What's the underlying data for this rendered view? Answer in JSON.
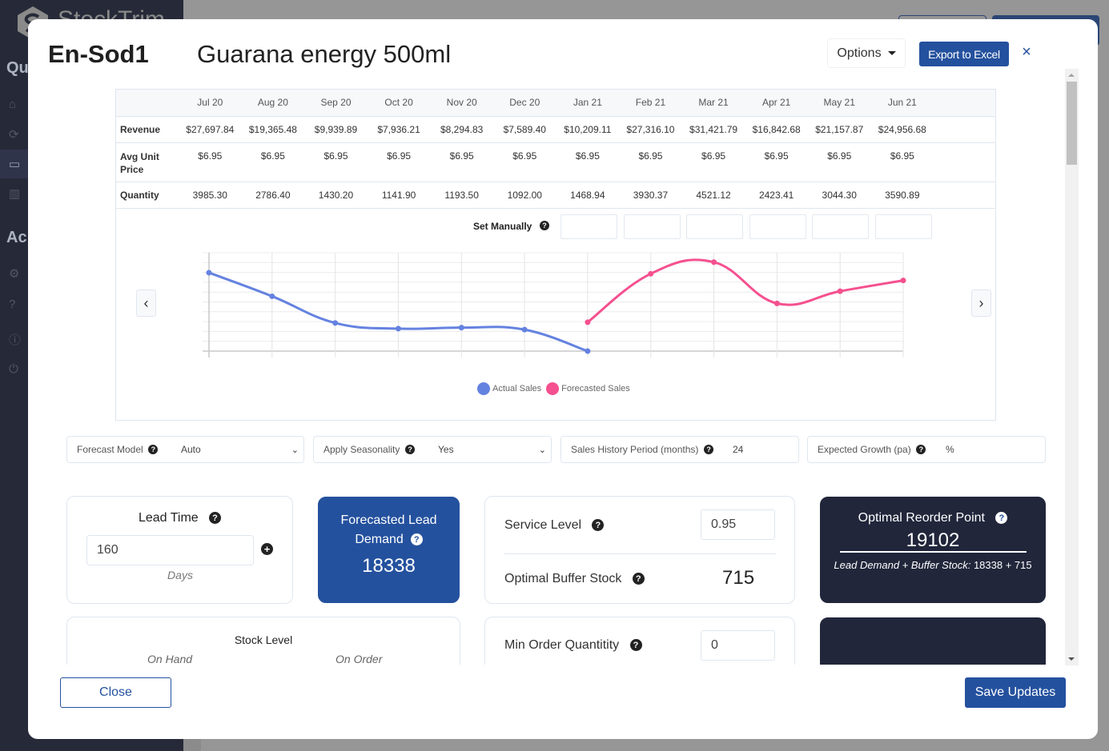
{
  "app": {
    "brand": "StockTrim",
    "sidebar_sections": [
      "Qu",
      "Ac"
    ],
    "sidebar_icons": [
      "home-icon",
      "refresh-icon",
      "wallet-icon",
      "building-icon",
      "gear-icon",
      "help-icon",
      "info-icon",
      "power-icon"
    ]
  },
  "modal": {
    "sku": "En-Sod1",
    "product_name": "Guarana energy 500ml",
    "options_label": "Options",
    "export_label": "Export to Excel",
    "close_symbol": "×"
  },
  "table": {
    "months": [
      "Jul 20",
      "Aug 20",
      "Sep 20",
      "Oct 20",
      "Nov 20",
      "Dec 20",
      "Jan 21",
      "Feb 21",
      "Mar 21",
      "Apr 21",
      "May 21",
      "Jun 21"
    ],
    "rows": [
      {
        "label": "Revenue",
        "values": [
          "$27,697.84",
          "$19,365.48",
          "$9,939.89",
          "$7,936.21",
          "$8,294.83",
          "$7,589.40",
          "$10,209.11",
          "$27,316.10",
          "$31,421.79",
          "$16,842.68",
          "$21,157.87",
          "$24,956.68"
        ]
      },
      {
        "label": "Avg Unit Price",
        "values": [
          "$6.95",
          "$6.95",
          "$6.95",
          "$6.95",
          "$6.95",
          "$6.95",
          "$6.95",
          "$6.95",
          "$6.95",
          "$6.95",
          "$6.95",
          "$6.95"
        ]
      },
      {
        "label": "Quantity",
        "values": [
          "3985.30",
          "2786.40",
          "1430.20",
          "1141.90",
          "1193.50",
          "1092.00",
          "1468.94",
          "3930.37",
          "4521.12",
          "2423.41",
          "3044.30",
          "3590.89"
        ]
      }
    ],
    "set_manually_label": "Set Manually",
    "manual_inputs": [
      "",
      "",
      "",
      "",
      "",
      ""
    ]
  },
  "chart_data": {
    "type": "line",
    "categories": [
      "Jul 20",
      "Aug 20",
      "Sep 20",
      "Oct 20",
      "Nov 20",
      "Dec 20",
      "Jan 21",
      "Feb 21",
      "Mar 21",
      "Apr 21",
      "May 21",
      "Jun 21"
    ],
    "series": [
      {
        "name": "Actual Sales",
        "color": "#6482e0",
        "values": [
          3985.3,
          2786.4,
          1430.2,
          1141.9,
          1193.5,
          1092.0,
          0,
          null,
          null,
          null,
          null,
          null
        ]
      },
      {
        "name": "Forecasted Sales",
        "color": "#f5508f",
        "values": [
          null,
          null,
          null,
          null,
          null,
          null,
          1468.94,
          3930.37,
          4521.12,
          2423.41,
          3044.3,
          3590.89
        ]
      }
    ],
    "ylim": [
      0,
      5000
    ],
    "grid": true,
    "legend": "bottom-center",
    "title": "",
    "xlabel": "",
    "ylabel": ""
  },
  "filters": {
    "forecast_model": {
      "label": "Forecast Model",
      "value": "Auto"
    },
    "seasonality": {
      "label": "Apply Seasonality",
      "value": "Yes"
    },
    "history": {
      "label": "Sales History Period (months)",
      "value": "24"
    },
    "growth": {
      "label": "Expected Growth (pa)",
      "value": "%"
    }
  },
  "cards": {
    "lead_time": {
      "title": "Lead Time",
      "value": "160",
      "unit": "Days"
    },
    "lead_demand": {
      "title": "Forecasted Lead Demand",
      "value": "18338"
    },
    "service_level": {
      "label": "Service Level",
      "value": "0.95"
    },
    "buffer_stock": {
      "label": "Optimal Buffer Stock",
      "value": "715"
    },
    "reorder_point": {
      "title": "Optimal Reorder Point",
      "value": "19102",
      "formula_label": "Lead Demand + Buffer Stock:",
      "formula_value": "18338 + 715"
    },
    "stock_level": {
      "title": "Stock Level",
      "on_hand": "On Hand",
      "on_order": "On Order"
    },
    "min_order": {
      "label": "Min Order Quantitity",
      "value": "0"
    }
  },
  "footer": {
    "close_label": "Close",
    "save_label": "Save Updates"
  }
}
